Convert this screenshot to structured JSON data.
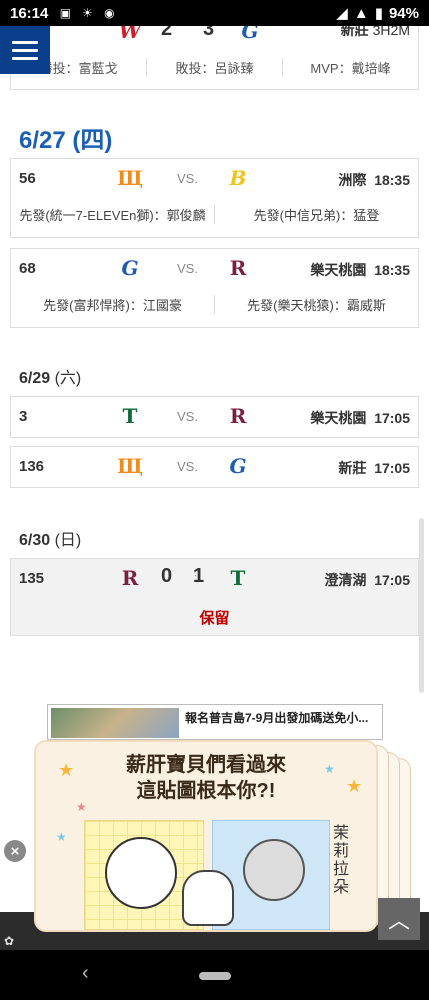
{
  "status_bar": {
    "time": "16:14",
    "battery": "94%",
    "icons": [
      "sim-icon",
      "brightness-icon",
      "app-icon",
      "wifi-icon",
      "signal-icon",
      "battery-icon"
    ]
  },
  "menu": {
    "icon": "hamburger-menu-icon"
  },
  "previous_game": {
    "away_score": "2",
    "home_score": "3",
    "location": "新莊",
    "duration": "3H2M",
    "winning_pitcher": "勝投：富藍戈",
    "losing_pitcher": "敗投：呂詠臻",
    "mvp": "MVP：戴培峰"
  },
  "date_0627": {
    "label": "6/27 (四)"
  },
  "game_56": {
    "number": "56",
    "vs": "VS.",
    "location": "洲際",
    "time": "18:35",
    "away_starter": "先發(統一7-ELEVEn獅)：郭俊麟",
    "home_starter": "先發(中信兄弟)：猛登",
    "away_team_logo": "Lions",
    "home_team_logo": "Brothers"
  },
  "game_68": {
    "number": "68",
    "vs": "VS.",
    "location": "樂天桃園",
    "time": "18:35",
    "away_starter": "先發(富邦悍將)：江國豪",
    "home_starter": "先發(樂天桃猿)：霸威斯",
    "away_team_logo": "Guardians",
    "home_team_logo": "Monkeys"
  },
  "date_0629": {
    "date": "6/29",
    "weekday": "(六)"
  },
  "game_3": {
    "number": "3",
    "vs": "VS.",
    "location": "樂天桃園",
    "time": "17:05",
    "away_team_logo": "Dragons",
    "home_team_logo": "Monkeys"
  },
  "game_136": {
    "number": "136",
    "vs": "VS.",
    "location": "新莊",
    "time": "17:05",
    "away_team_logo": "Lions",
    "home_team_logo": "Guardians"
  },
  "date_0630": {
    "date": "6/30",
    "weekday": "(日)"
  },
  "game_135": {
    "number": "135",
    "away_score": "0",
    "home_score": "1",
    "location": "澄清湖",
    "time": "17:05",
    "status": "保留",
    "away_team_logo": "Monkeys",
    "home_team_logo": "Dragons"
  },
  "ad": {
    "banner_text": "報名普吉島7-9月出發加碼送免小...",
    "popup_title_line1": "薪肝寶貝們看過來",
    "popup_title_line2": "這貼圖根本你?!",
    "popup_vertical_text": "茉莉拉朵"
  },
  "colors": {
    "accent_blue": "#1a5fb4",
    "menu_blue": "#0b3f8c",
    "hold_red": "#c00000",
    "lions_orange": "#f08c1e",
    "brothers_yellow": "#f0c419",
    "guardians_blue": "#1f5bb0",
    "monkeys_maroon": "#7a1f3d",
    "dragons_green": "#0f6b3a",
    "wildcat_red": "#cc1f2a"
  }
}
